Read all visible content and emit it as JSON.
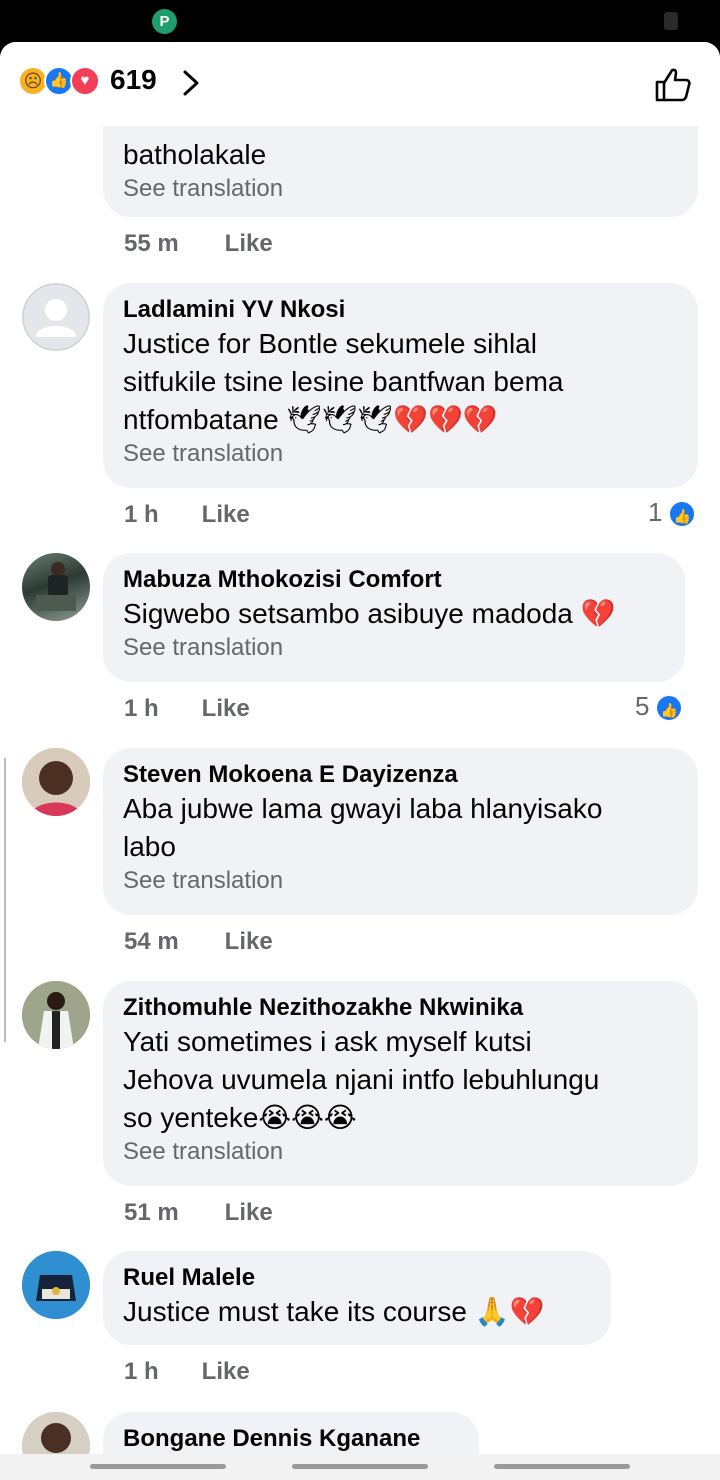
{
  "status_bar": {
    "app_icon": "pushbullet-icon",
    "app_glyph": "P"
  },
  "header": {
    "reaction_icons": [
      "sad-reaction-icon",
      "like-reaction-icon",
      "love-reaction-icon"
    ],
    "reaction_count": "619",
    "like_icon": "thumbs-up-outline-icon"
  },
  "comments": [
    {
      "author": "",
      "text": "batholakale",
      "translate": "See translation",
      "time": "55 m",
      "like": "Like",
      "reactions": ""
    },
    {
      "author": "Ladlamini YV Nkosi",
      "text": "Justice for  Bontle  sekumele  sihlal\nsitfukile tsine  lesine  bantfwan  bema\nntfombatane 🕊🕊🕊💔💔💔",
      "translate": "See translation",
      "time": "1 h",
      "like": "Like",
      "reactions": "1"
    },
    {
      "author": "Mabuza Mthokozisi Comfort",
      "text": "Sigwebo setsambo asibuye madoda 💔",
      "translate": "See translation",
      "time": "1 h",
      "like": "Like",
      "reactions": "5"
    },
    {
      "author": "Steven Mokoena E Dayizenza",
      "text": "Aba jubwe lama gwayi laba hlanyisako\nlabo",
      "translate": "See translation",
      "time": "54 m",
      "like": "Like",
      "reactions": ""
    },
    {
      "author": "Zithomuhle Nezithozakhe Nkwinika",
      "text": "Yati sometimes i ask myself kutsi\nJehova uvumela njani intfo lebuhlungu\nso yenteke😭😭😭",
      "translate": "See translation",
      "time": "51 m",
      "like": "Like",
      "reactions": ""
    },
    {
      "author": "Ruel Malele",
      "text": "Justice must take its course 🙏💔",
      "translate": "",
      "time": "1 h",
      "like": "Like",
      "reactions": ""
    },
    {
      "author": "Bongane Dennis Kganane",
      "text": "",
      "translate": "",
      "time": "",
      "like": "",
      "reactions": ""
    }
  ]
}
